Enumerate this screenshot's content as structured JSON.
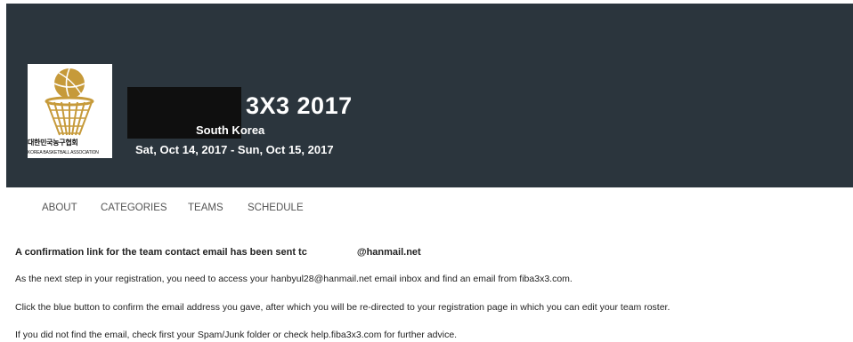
{
  "logo": {
    "korean_text": "대한민국농구협회",
    "english_text": "KOREA BASKETBALL ASSOCIATION",
    "icon": "basketball-net-icon",
    "brand_color": "#c69a3a"
  },
  "event": {
    "title": "3X3 2017",
    "country": "South Korea",
    "dates": "Sat, Oct 14, 2017 - Sun, Oct 15, 2017"
  },
  "nav": {
    "tabs": [
      {
        "label": "ABOUT"
      },
      {
        "label": "CATEGORIES"
      },
      {
        "label": "TEAMS"
      },
      {
        "label": "SCHEDULE"
      }
    ]
  },
  "content": {
    "confirmation_prefix": "A confirmation link for the team contact email has been sent tc",
    "confirmation_suffix": "@hanmail.net",
    "line1": "As the next step in your registration, you need to access your hanbyul28@hanmail.net email inbox and find an email from fiba3x3.com.",
    "line2": "Click the blue button to confirm the email address you gave, after which you will be re-directed to your registration page in which you can edit your team roster.",
    "line3": "If you did not find the email, check first your Spam/Junk folder or check help.fiba3x3.com for further advice."
  },
  "colors": {
    "header_bg": "#2b353d",
    "nav_text": "#555555"
  }
}
